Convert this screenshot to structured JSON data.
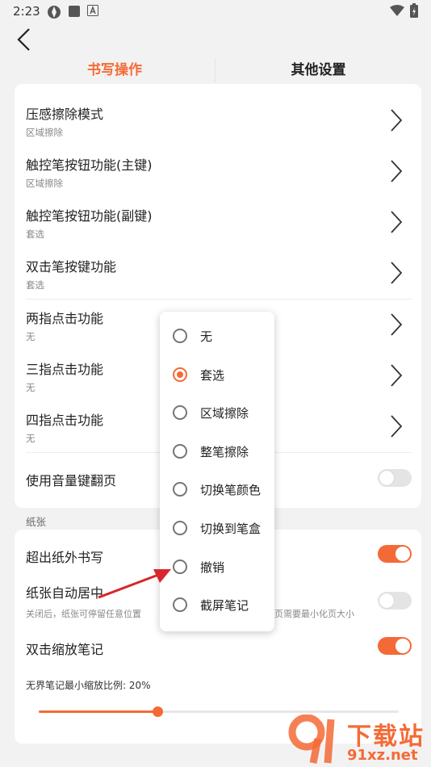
{
  "status": {
    "time": "2:23"
  },
  "tabs": [
    {
      "label": "书写操作",
      "active": true
    },
    {
      "label": "其他设置",
      "active": false
    }
  ],
  "settings": [
    {
      "title": "压感擦除模式",
      "sub": "区域擦除"
    },
    {
      "title": "触控笔按钮功能(主键)",
      "sub": "区域擦除"
    },
    {
      "title": "触控笔按钮功能(副键)",
      "sub": "套选"
    },
    {
      "title": "双击笔按键功能",
      "sub": "套选"
    },
    {
      "title": "两指点击功能",
      "sub": "无"
    },
    {
      "title": "三指点击功能",
      "sub": "无"
    },
    {
      "title": "四指点击功能",
      "sub": "无"
    }
  ],
  "volume_page": {
    "title": "使用音量键翻页",
    "on": false
  },
  "paper": {
    "section_label": "纸张",
    "outside_writing": {
      "title": "超出纸外书写",
      "on": true
    },
    "auto_center": {
      "title": "纸张自动居中",
      "desc_left": "关闭后，纸张可停留任意位置",
      "desc_right": "页需要最小化页大小",
      "on": false
    },
    "double_tap_zoom": {
      "title": "双击缩放笔记",
      "on": true
    },
    "min_zoom": {
      "label": "无界笔记最小缩放比例: 20%",
      "value_pct": 33
    }
  },
  "popup": {
    "options": [
      "无",
      "套选",
      "区域擦除",
      "整笔擦除",
      "切换笔颜色",
      "切换到笔盒",
      "撤销",
      "截屏笔记"
    ],
    "selected_index": 1
  },
  "watermark": {
    "brand": "下载站",
    "domain": "91xz.net"
  },
  "colors": {
    "accent": "#f46a36",
    "background": "#f2f2f2",
    "arrow": "#d8262b"
  }
}
